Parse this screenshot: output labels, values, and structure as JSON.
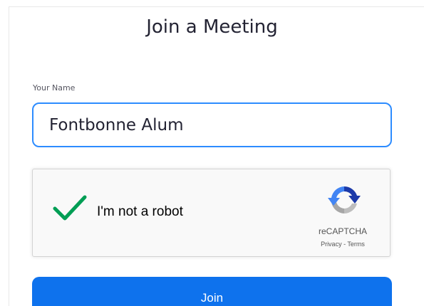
{
  "title": "Join a Meeting",
  "name_field": {
    "label": "Your Name",
    "value": "Fontbonne Alum"
  },
  "recaptcha": {
    "checked": true,
    "label": "I'm not a robot",
    "brand": "reCAPTCHA",
    "privacy_link": "Privacy",
    "separator": " - ",
    "terms_link": "Terms",
    "check_color": "#009e55"
  },
  "join_button": {
    "label": "Join",
    "color": "#0e72ed"
  }
}
